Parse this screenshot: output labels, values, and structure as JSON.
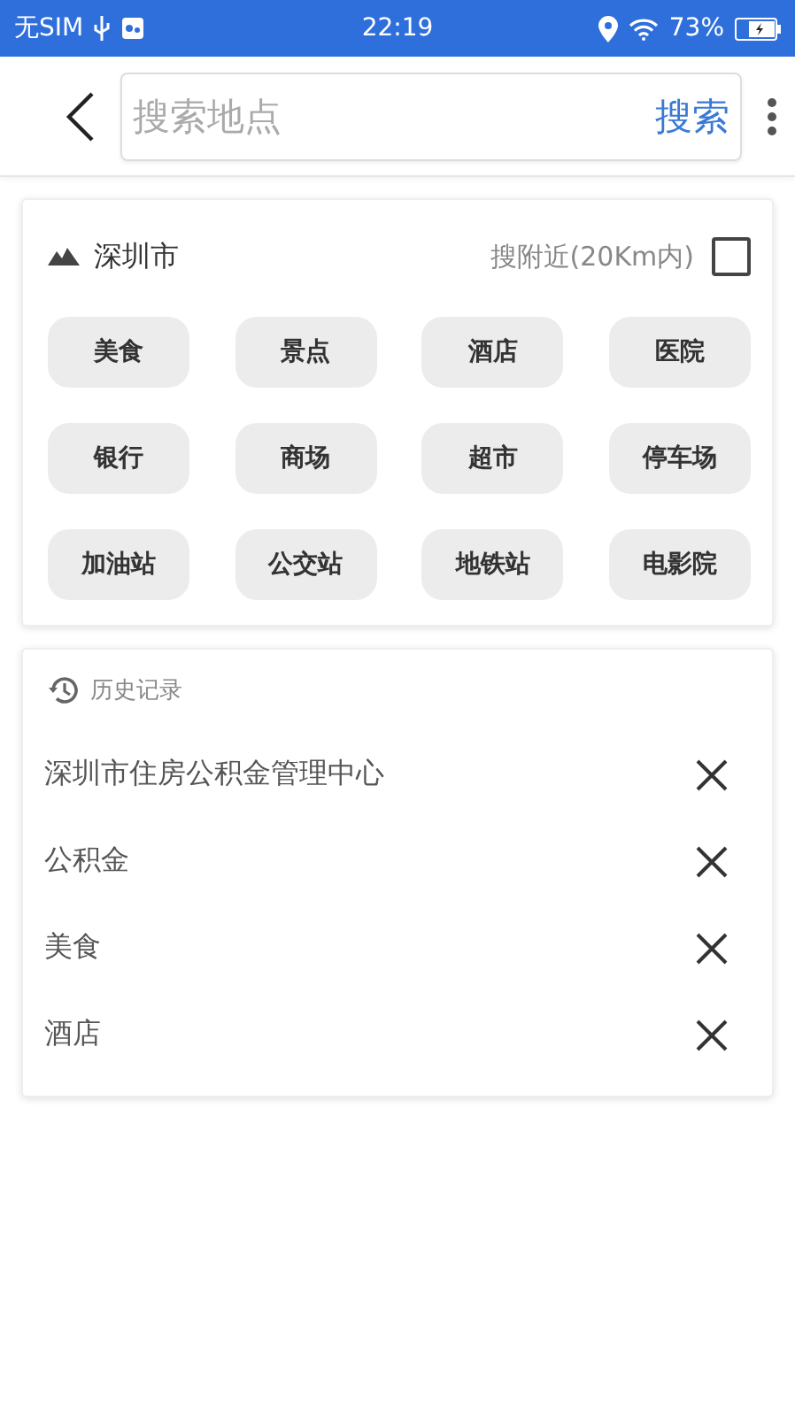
{
  "status_bar": {
    "carrier": "无SIM",
    "time": "22:19",
    "battery": "73%"
  },
  "search": {
    "placeholder": "搜索地点",
    "button": "搜索"
  },
  "city": {
    "name": "深圳市",
    "nearby": {
      "label": "搜附近(20Km内)",
      "checked": false
    }
  },
  "categories": [
    "美食",
    "景点",
    "酒店",
    "医院",
    "银行",
    "商场",
    "超市",
    "停车场",
    "加油站",
    "公交站",
    "地铁站",
    "电影院"
  ],
  "history": {
    "title": "历史记录",
    "items": [
      "深圳市住房公积金管理中心",
      "公积金",
      "美食",
      "酒店"
    ]
  }
}
